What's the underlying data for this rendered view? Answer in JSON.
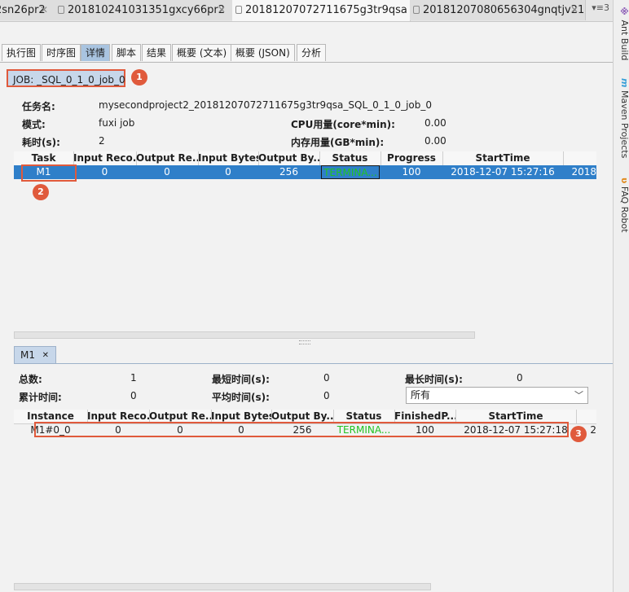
{
  "editor_tabs": [
    {
      "label": "2sn26pr2"
    },
    {
      "label": "201810241031351gxcy66pr2"
    },
    {
      "label": "20181207072711675g3tr9qsa"
    },
    {
      "label": "20181207080656304gnqtjv21"
    }
  ],
  "tab_overflow": "▾≡3",
  "tool_strip": [
    "Ant Build",
    "Maven Projects",
    "FAQ Robot"
  ],
  "sub_tabs": [
    "执行图",
    "时序图",
    "详情",
    "脚本",
    "结果",
    "概要 (文本)",
    "概要 (JSON)",
    "分析"
  ],
  "job_label": "JOB: _SQL_0_1_0_job_0",
  "markers": [
    "1",
    "2",
    "3"
  ],
  "info": {
    "task_name_label": "任务名:",
    "task_name_value": "mysecondproject2_20181207072711675g3tr9qsa_SQL_0_1_0_job_0",
    "mode_label": "模式:",
    "mode_value": "fuxi job",
    "cpu_label": "CPU用量(core*min):",
    "cpu_value": "0.00",
    "duration_label": "耗时(s):",
    "duration_value": "2",
    "mem_label": "内存用量(GB*min):",
    "mem_value": "0.00"
  },
  "task_table": {
    "columns": [
      "Task",
      "Input Reco...",
      "Output Re...",
      "Input Bytes",
      "Output By...",
      "Status",
      "Progress",
      "StartTime",
      ""
    ],
    "rows": [
      [
        "M1",
        "0",
        "0",
        "0",
        "256",
        "TERMINA...",
        "100",
        "2018-12-07 15:27:16",
        "2018"
      ]
    ]
  },
  "m1_tab": {
    "label": "M1"
  },
  "stats": {
    "total_label": "总数:",
    "total_value": "1",
    "min_time_label": "最短时间(s):",
    "min_time_value": "0",
    "max_time_label": "最长时间(s):",
    "max_time_value": "0",
    "cum_time_label": "累计时间:",
    "cum_time_value": "0",
    "avg_time_label": "平均时间(s):",
    "avg_time_value": "0",
    "filter_selected": "所有"
  },
  "instance_table": {
    "columns": [
      "Instance",
      "Input Reco...",
      "Output Re...",
      "Input Bytes",
      "Output By...",
      "Status",
      "FinishedP...",
      "StartTime",
      ""
    ],
    "rows": [
      [
        "M1#0_0",
        "0",
        "0",
        "0",
        "256",
        "TERMINA...",
        "100",
        "2018-12-07 15:27:18",
        "2"
      ]
    ]
  },
  "colors": {
    "accent": "#2f7fc9",
    "marker": "#e05a3c",
    "status": "#22c322"
  }
}
